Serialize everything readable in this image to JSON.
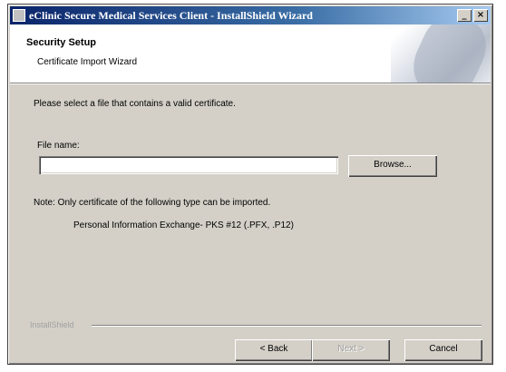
{
  "window": {
    "title": "eClinic Secure Medical Services Client - InstallShield Wizard",
    "minimize_glyph": "_",
    "close_glyph": "×"
  },
  "header": {
    "title": "Security Setup",
    "subtitle": "Certificate Import Wizard"
  },
  "body": {
    "prompt": "Please select a file that contains a valid certificate.",
    "file_label": "File name:",
    "file_value": "",
    "browse_label": "Browse...",
    "note": "Note: Only certificate of the following type can be imported.",
    "note_detail": "Personal Information Exchange- PKS #12 (.PFX, .P12)"
  },
  "footer": {
    "brand": "InstallShield",
    "back_label": "< Back",
    "next_label": "Next >",
    "cancel_label": "Cancel"
  }
}
